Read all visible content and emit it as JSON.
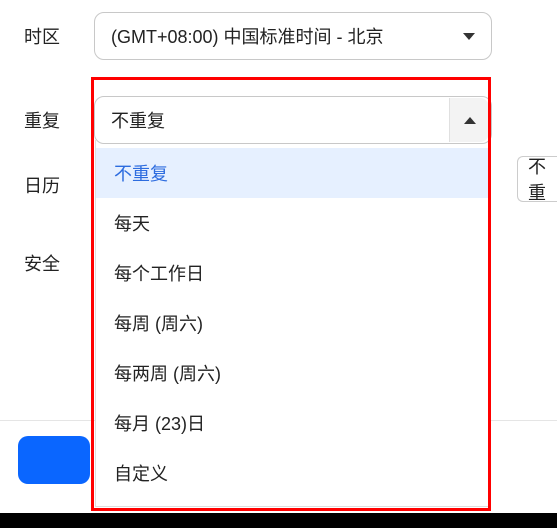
{
  "labels": {
    "timezone": "时区",
    "repeat": "重复",
    "calendar": "日历",
    "security": "安全"
  },
  "timezone": {
    "value": "(GMT+08:00) 中国标准时间 - 北京"
  },
  "repeat": {
    "value": "不重复",
    "options": {
      "none": "不重复",
      "daily": "每天",
      "weekdays": "每个工作日",
      "weekly": "每周 (周六)",
      "biweekly": "每两周 (周六)",
      "monthly": "每月 (23)日",
      "custom": "自定义"
    }
  },
  "peek_text": "不重"
}
